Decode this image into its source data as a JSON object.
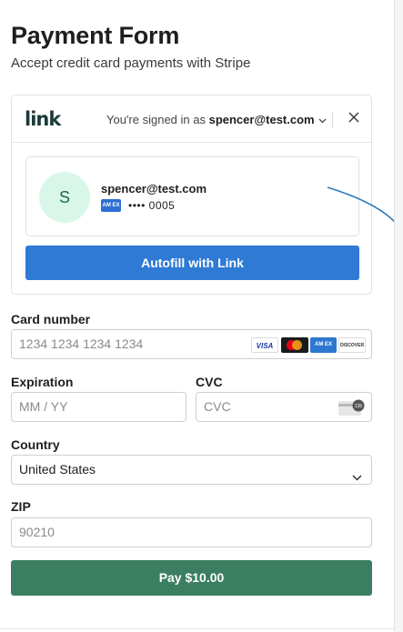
{
  "header": {
    "title": "Payment Form",
    "subtitle": "Accept credit card payments with Stripe"
  },
  "link": {
    "logo": "link",
    "signed_in_prefix": "You're signed in as ",
    "signed_in_email": "spencer@test.com",
    "account": {
      "avatar_initial": "S",
      "email": "spencer@test.com",
      "card_brand": "amex",
      "masked_number": "•••• 0005"
    },
    "autofill_label": "Autofill with Link"
  },
  "form": {
    "card_number": {
      "label": "Card number",
      "placeholder": "1234 1234 1234 1234",
      "brands": [
        "VISA",
        "Mastercard",
        "American Express",
        "DISCOVER"
      ]
    },
    "expiration": {
      "label": "Expiration",
      "placeholder": "MM / YY"
    },
    "cvc": {
      "label": "CVC",
      "placeholder": "CVC",
      "icon_text": "135"
    },
    "country": {
      "label": "Country",
      "value": "United States"
    },
    "zip": {
      "label": "ZIP",
      "placeholder": "90210"
    },
    "pay_label": "Pay $10.00"
  },
  "colors": {
    "link_button": "#2f7ad4",
    "pay_button": "#3b7e62",
    "avatar_bg": "#d8f7e8",
    "annotation": "#2f7ab8"
  }
}
